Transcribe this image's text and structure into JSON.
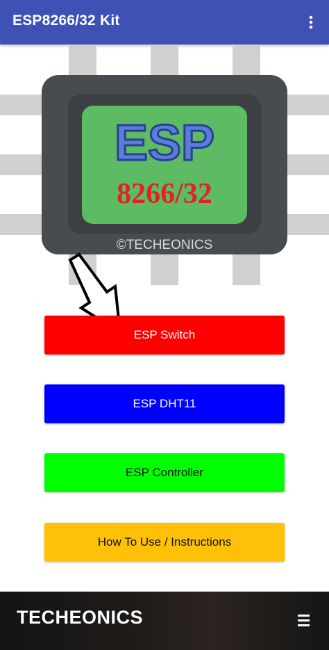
{
  "appbar": {
    "title": "ESP8266/32 Kit",
    "overflow_icon": "more-vert-icon",
    "color": "#3f51b5"
  },
  "hero": {
    "chip_top": "ESP",
    "chip_bottom": "8266/32",
    "watermark": "©TECHEONICS",
    "arrow_icon": "arrow-down-icon"
  },
  "buttons": [
    {
      "label": "ESP Switch",
      "color": "#ff0000"
    },
    {
      "label": "ESP DHT11",
      "color": "#0000ff"
    },
    {
      "label": "ESP Controller",
      "color": "#00ff00"
    },
    {
      "label": "How To Use / Instructions",
      "color": "#ffc107"
    }
  ],
  "footer": {
    "brand": "TECHEONICS",
    "menu_icon": "hamburger-menu-icon"
  }
}
